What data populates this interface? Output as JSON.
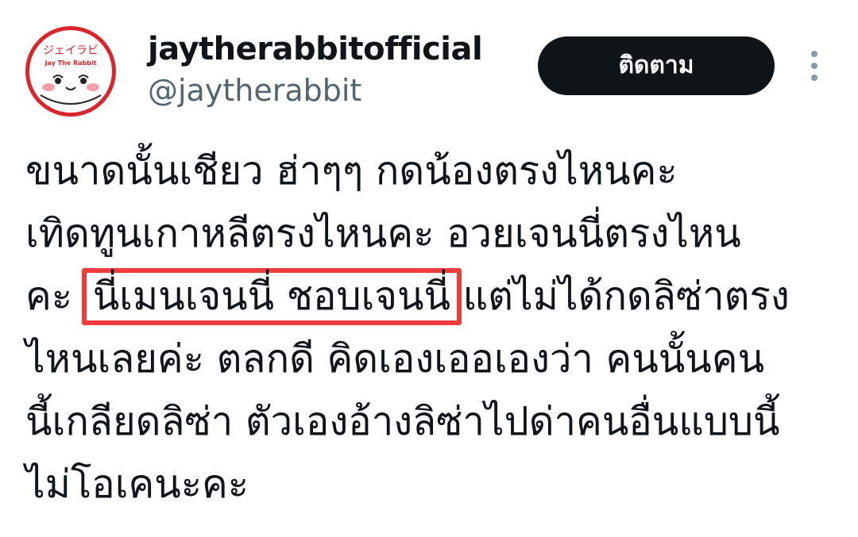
{
  "user": {
    "display_name": "jaytherabbitofficial",
    "handle": "@jaytherabbit",
    "avatar": {
      "top_text": "ジェイラビ",
      "sub_text": "Jay The Rabbit",
      "ring_color": "#d8262c"
    }
  },
  "follow_button": {
    "label": "ติดตาม"
  },
  "more_menu": {
    "icon": "more-vertical-icon"
  },
  "tweet": {
    "line1": "ขนาดนั้นเชียว ฮ่าๆๆ  กดน้องตรงไหนคะ",
    "line2": "เทิดทูนเกาหลีตรงไหนคะ อวยเจนนี่ตรงไหน",
    "line3_before": "คะ ",
    "line3_highlight": "นี่เมนเจนนี่ ชอบเจนนี่",
    "line3_after": " แต่ไม่ได้กดลิซ่าตรง",
    "line4": "ไหนเลยค่ะ ตลกดี คิดเองเออเองว่า คนนั้นคน",
    "line5": "นี้เกลียดลิซ่า ตัวเองอ้างลิซ่าไปด่าคนอื่นแบบนี้",
    "line6": "ไม่โอเคนะคะ"
  },
  "colors": {
    "highlight_border": "#ee3c3c",
    "follow_bg": "#0f1419",
    "handle": "#536471"
  }
}
